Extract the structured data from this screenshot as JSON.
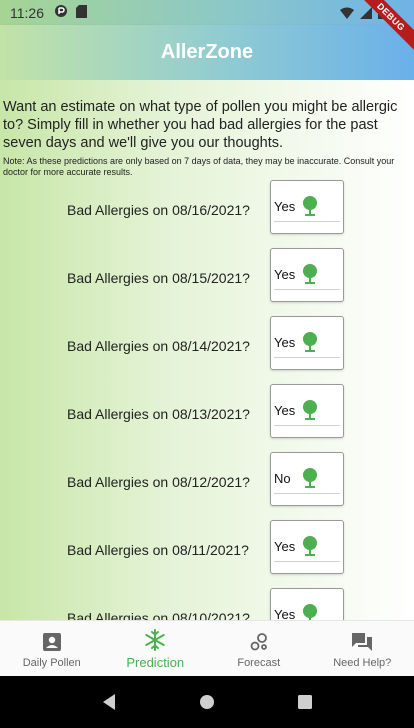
{
  "status_bar": {
    "time": "11:26",
    "debug_label": "DEBUG"
  },
  "app_bar": {
    "title": "AllerZone"
  },
  "intro_text": "Want an estimate on what type of pollen you might be allergic to? Simply fill in whether you had bad allergies for the past seven days and we'll give you our thoughts.",
  "note_text": "Note: As these predictions are only based on 7 days of data, they may be inaccurate. Consult your doctor for more accurate results.",
  "rows": [
    {
      "label": "Bad Allergies on 08/16/2021?",
      "value": "Yes"
    },
    {
      "label": "Bad Allergies on 08/15/2021?",
      "value": "Yes"
    },
    {
      "label": "Bad Allergies on 08/14/2021?",
      "value": "Yes"
    },
    {
      "label": "Bad Allergies on 08/13/2021?",
      "value": "Yes"
    },
    {
      "label": "Bad Allergies on 08/12/2021?",
      "value": "No"
    },
    {
      "label": "Bad Allergies on 08/11/2021?",
      "value": "Yes"
    },
    {
      "label": "Bad Allergies on 08/10/2021?",
      "value": "Yes"
    }
  ],
  "bottom_nav": [
    {
      "label": "Daily Pollen",
      "icon": "account-box-icon"
    },
    {
      "label": "Prediction",
      "icon": "snowflake-icon",
      "active": true
    },
    {
      "label": "Forecast",
      "icon": "bubbles-icon"
    },
    {
      "label": "Need Help?",
      "icon": "forum-icon"
    }
  ],
  "colors": {
    "accent": "#4caf50",
    "tree_icon": "#4caf50"
  }
}
